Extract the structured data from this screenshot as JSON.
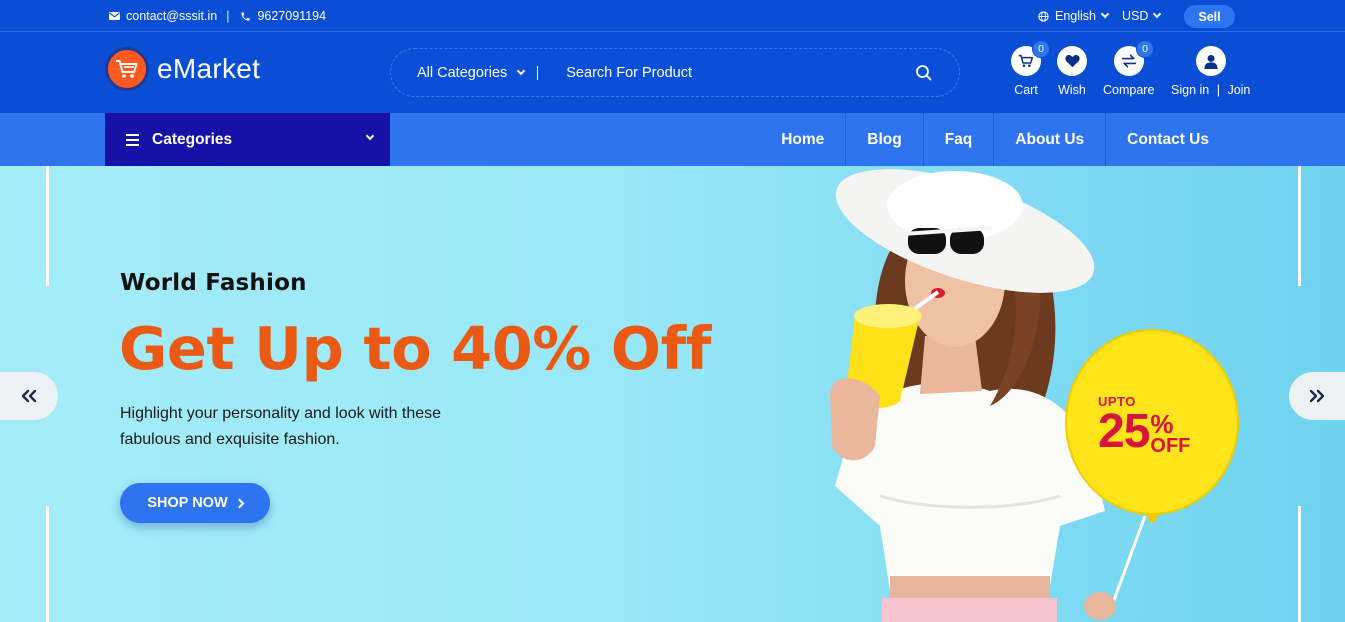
{
  "topbar": {
    "email": "contact@sssit.in",
    "phone": "9627091194",
    "separator": "|",
    "language": "English",
    "currency": "USD",
    "sell_label": "Sell"
  },
  "header": {
    "brand": "eMarket",
    "search": {
      "category": "All Categories",
      "placeholder": "Search For Product"
    },
    "icons": {
      "cart": {
        "label": "Cart",
        "count": "0"
      },
      "wish": {
        "label": "Wish"
      },
      "compare": {
        "label": "Compare",
        "count": "0"
      },
      "signin": {
        "label": "Sign in",
        "sep": "|",
        "join": "Join"
      }
    }
  },
  "nav": {
    "categories_label": "Categories",
    "items": [
      "Home",
      "Blog",
      "Faq",
      "About Us",
      "Contact Us"
    ]
  },
  "hero": {
    "subtitle": "World Fashion",
    "headline": "Get Up to 40% Off",
    "description_line1": "Highlight your personality and look with these",
    "description_line2": "fabulous and exquisite fashion.",
    "cta": "SHOP NOW",
    "balloon": {
      "upto": "UPTO",
      "percent": "25",
      "sign": "%",
      "off": "OFF"
    }
  },
  "colors": {
    "primary": "#0a4ed6",
    "nav": "#2d74ee",
    "categories": "#1711a8",
    "accent": "#eb5a14",
    "balloon_text": "#d6143c",
    "balloon": "#ffe21a"
  }
}
